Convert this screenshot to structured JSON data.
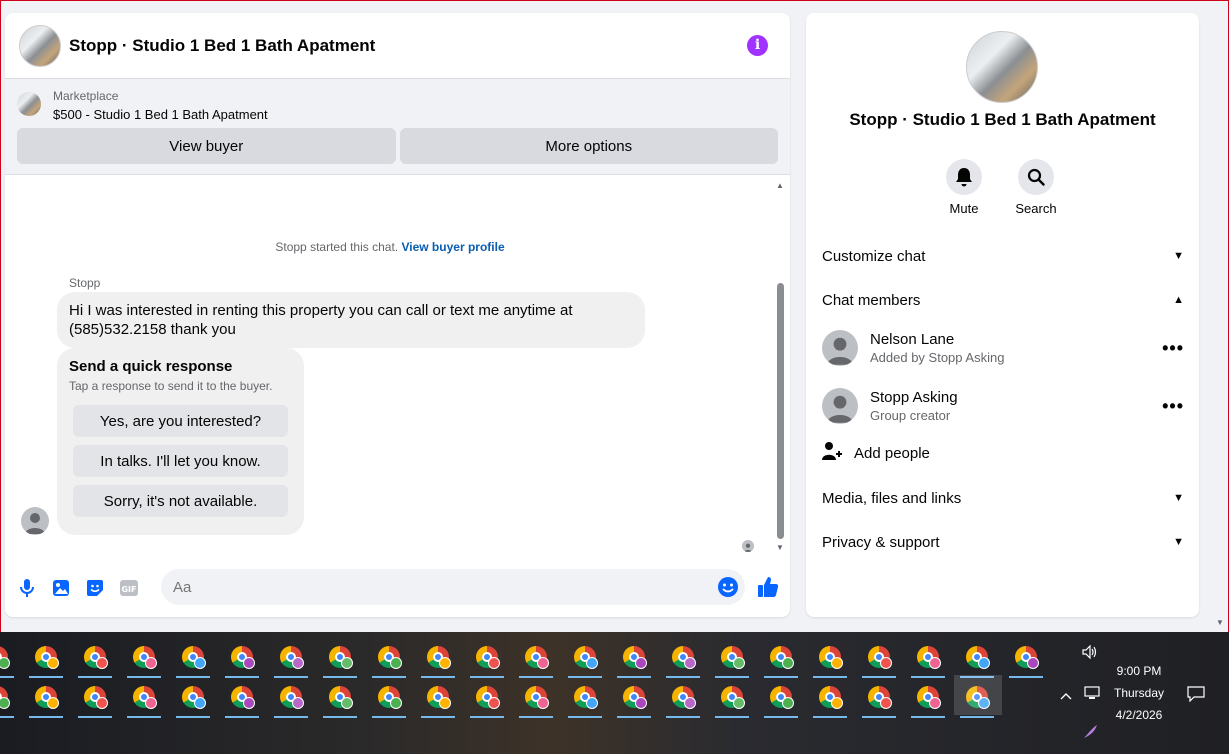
{
  "chat": {
    "title": "Stopp · Studio 1 Bed 1 Bath Apatment",
    "marketplace_label": "Marketplace",
    "marketplace_item": "$500 - Studio 1 Bed 1 Bath Apatment",
    "view_buyer": "View buyer",
    "more_options": "More options",
    "system_text": "Stopp started this chat.",
    "system_link": "View buyer profile",
    "sender": "Stopp",
    "message": "Hi I was interested in renting this property you can call or text me anytime at (585)532.2158 thank you",
    "quick_title": "Send a quick response",
    "quick_sub": "Tap a response to send it to the buyer.",
    "quick_responses": [
      "Yes, are you interested?",
      "In talks. I'll let you know.",
      "Sorry, it's not available."
    ],
    "input_placeholder": "Aa"
  },
  "info": {
    "title": "Stopp · Studio 1 Bed 1 Bath Apatment",
    "mute": "Mute",
    "search": "Search",
    "customize": "Customize chat",
    "members_header": "Chat members",
    "members": [
      {
        "name": "Nelson Lane",
        "sub": "Added by Stopp Asking"
      },
      {
        "name": "Stopp Asking",
        "sub": "Group creator"
      }
    ],
    "add_people": "Add people",
    "media": "Media, files and links",
    "privacy": "Privacy & support"
  },
  "taskbar": {
    "time": "9:00 PM",
    "day": "Thursday",
    "date": "4/2/2026"
  },
  "colors": {
    "accent": "#0866ff",
    "info_purple": "#a033ff",
    "link": "#0a5eb0"
  }
}
